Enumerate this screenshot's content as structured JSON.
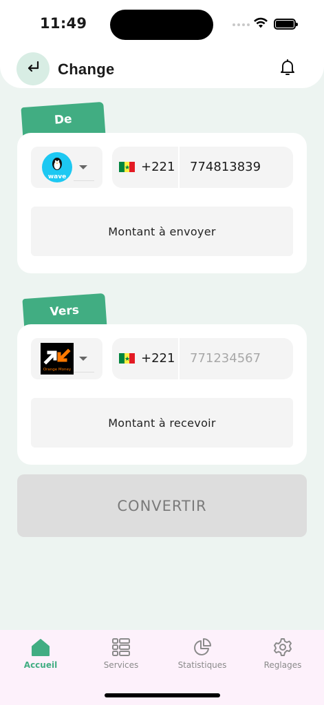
{
  "status": {
    "time": "11:49"
  },
  "header": {
    "title": "Change",
    "back_icon": "return-arrow-icon",
    "bell_icon": "bell-icon"
  },
  "colors": {
    "accent": "#41ad82",
    "background": "#edf4f1",
    "tabbar": "#fdf1fb",
    "disabled": "#dddddd"
  },
  "from": {
    "tag": "De",
    "operator": {
      "name": "wave",
      "icon": "wave-logo"
    },
    "dial_code": "+221",
    "phone_value": "774813839",
    "amount_placeholder": "Montant à envoyer"
  },
  "to": {
    "tag": "Vers",
    "operator": {
      "name": "Orange Money",
      "icon": "orange-money-logo"
    },
    "dial_code": "+221",
    "phone_placeholder": "771234567",
    "amount_placeholder": "Montant à recevoir"
  },
  "convert_button": "CONVERTIR",
  "tabs": [
    {
      "label": "Accueil",
      "icon": "home-icon",
      "active": true
    },
    {
      "label": "Services",
      "icon": "services-icon",
      "active": false
    },
    {
      "label": "Statistiques",
      "icon": "pie-chart-icon",
      "active": false
    },
    {
      "label": "Reglages",
      "icon": "gear-icon",
      "active": false
    }
  ]
}
